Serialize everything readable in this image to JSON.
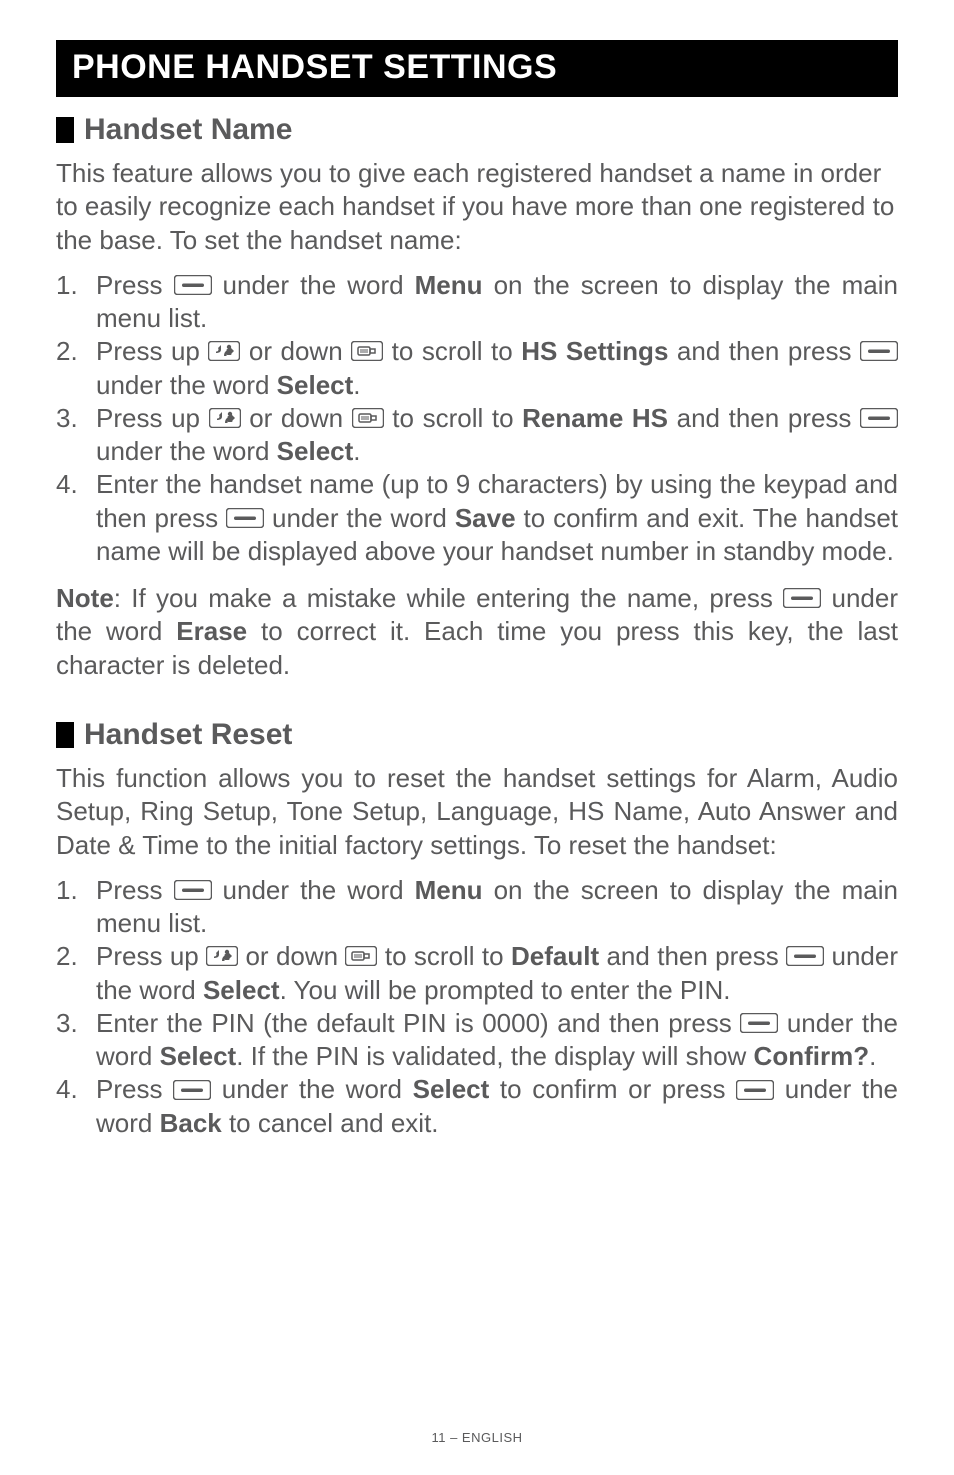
{
  "title": "PHONE HANDSET SETTINGS",
  "section1": {
    "heading": "Handset Name",
    "intro": "This feature allows you to give each registered handset a name in order to easily recognize each handset if you have more than one registered to the base.  To set the handset name:",
    "step1_a": "Press ",
    "step1_b": " under the word ",
    "step1_menu": "Menu",
    "step1_c": " on the screen to display the main menu list.",
    "step2_a": "Press up ",
    "step2_b": " or down ",
    "step2_c": " to scroll to ",
    "step2_hs": "HS Settings",
    "step2_d": " and then press ",
    "step2_e": " under the word ",
    "step2_select": "Select",
    "step2_f": ".",
    "step3_a": "Press up ",
    "step3_b": " or down ",
    "step3_c": " to scroll to ",
    "step3_rename": "Rename HS",
    "step3_d": " and then press ",
    "step3_e": " under the word ",
    "step3_select": "Select",
    "step3_f": ".",
    "step4_a": "Enter the handset name (up to 9 characters) by using the keypad and then press ",
    "step4_b": " under the word ",
    "step4_save": "Save",
    "step4_c": " to confirm and exit. The handset name will be displayed above your handset number in standby mode.",
    "note_label": "Note",
    "note_a": ": If you make a mistake while entering the name, press ",
    "note_b": " under the word ",
    "note_erase": "Erase",
    "note_c": " to correct it. Each time you press this key, the last character is deleted."
  },
  "section2": {
    "heading": "Handset Reset",
    "intro": "This function allows you to reset the handset settings for Alarm, Audio Setup, Ring Setup, Tone Setup, Language, HS Name, Auto Answer and Date & Time to the initial factory settings.  To reset the handset:",
    "step1_a": "Press ",
    "step1_b": " under the word ",
    "step1_menu": "Menu",
    "step1_c": " on the screen to display the main menu list.",
    "step2_a": "Press up ",
    "step2_b": " or down ",
    "step2_c": " to scroll to ",
    "step2_default": "Default",
    "step2_d": " and then press ",
    "step2_e": " under the word ",
    "step2_select": "Select",
    "step2_f": ". You will be prompted to enter the PIN.",
    "step3_a": "Enter the PIN (the default PIN is 0000) and then press ",
    "step3_b": " under the word ",
    "step3_select": "Select",
    "step3_c": ". If the PIN is validated, the display will show ",
    "step3_confirm": "Confirm?",
    "step3_d": ".",
    "step4_a": "Press ",
    "step4_b": " under the word ",
    "step4_select": "Select",
    "step4_c": " to confirm or press ",
    "step4_d": " under the word ",
    "step4_back": "Back",
    "step4_e": " to cancel and exit."
  },
  "footer": "11 – ENGLISH"
}
